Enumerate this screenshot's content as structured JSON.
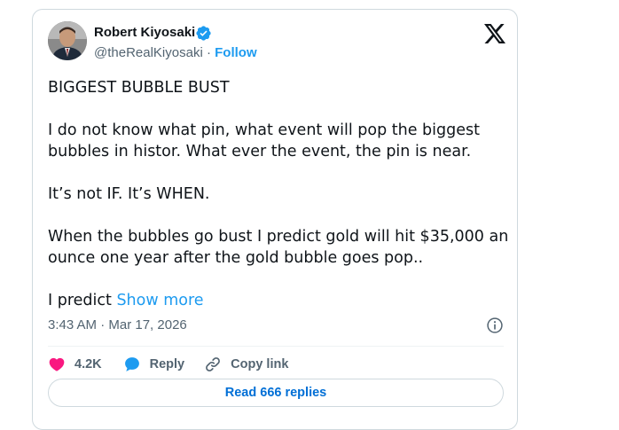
{
  "author": {
    "name": "Robert Kiyosaki",
    "handle": "@theRealKiyosaki",
    "separator": " · ",
    "follow_label": "Follow",
    "verified_color": "#1d9bf0"
  },
  "tweet": {
    "paragraphs": [
      "BIGGEST BUBBLE BUST",
      "I do not know what pin, what event will pop the biggest bubbles in histor.  What ever the event, the pin is near.",
      "It’s not IF.  It’s WHEN.",
      "When the bubbles go bust I predict gold will hit $35,000 an ounce one year after the gold bubble goes pop.."
    ],
    "truncated_text": "I predict ",
    "show_more_label": "Show more",
    "timestamp": "3:43 AM · Mar 17, 2026"
  },
  "actions": {
    "like_count": "4.2K",
    "reply_label": "Reply",
    "copy_link_label": "Copy link",
    "like_color": "#f91880",
    "reply_color": "#1d9bf0"
  },
  "footer": {
    "read_replies_label": "Read 666 replies"
  },
  "icons": {
    "platform_logo": "x-logo-icon",
    "info": "info-icon",
    "like": "heart-icon",
    "reply": "speech-bubble-icon",
    "copy_link": "link-icon",
    "verified": "verified-badge-icon"
  }
}
